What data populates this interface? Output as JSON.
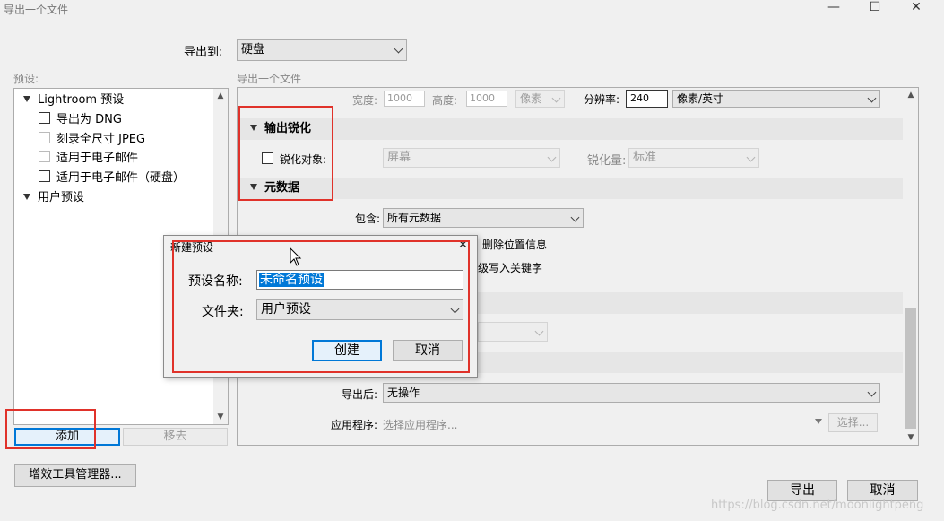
{
  "window": {
    "title": "导出一个文件",
    "minimize_glyph": "—",
    "maximize_glyph": "☐",
    "close_glyph": "✕"
  },
  "export_to": {
    "label": "导出到:",
    "value": "硬盘"
  },
  "presets": {
    "label": "预设:",
    "groups": [
      {
        "label": "Lightroom 预设"
      },
      {
        "label": "用户预设"
      }
    ],
    "items": [
      {
        "label": "导出为 DNG"
      },
      {
        "label": "刻录全尺寸 JPEG"
      },
      {
        "label": "适用于电子邮件"
      },
      {
        "label": "适用于电子邮件（硬盘）"
      }
    ],
    "add_label": "添加",
    "remove_label": "移去"
  },
  "plugin_manager_label": "增效工具管理器...",
  "main": {
    "heading": "导出一个文件",
    "size_row": {
      "width_label": "宽度:",
      "width_value": "1000",
      "height_label": "高度:",
      "height_value": "1000",
      "unit_value": "像素",
      "resolution_label": "分辨率:",
      "resolution_value": "240",
      "resolution_unit": "像素/英寸"
    },
    "sharpening": {
      "title": "输出锐化",
      "checkbox_label": "锐化对象:",
      "target_value": "屏幕",
      "amount_label": "锐化量:",
      "amount_value": "标准"
    },
    "metadata": {
      "title": "元数据",
      "include_label": "包含:",
      "include_value": "所有元数据",
      "remove_location_label": "删除位置信息",
      "keywords_label": "级写入关键字"
    },
    "post_processing": {
      "after_export_label": "导出后:",
      "after_export_value": "无操作",
      "application_label": "应用程序:",
      "application_placeholder": "选择应用程序...",
      "choose_label": "选择..."
    }
  },
  "new_preset_dialog": {
    "title": "新建预设",
    "name_label": "预设名称:",
    "name_value": "未命名预设",
    "folder_label": "文件夹:",
    "folder_value": "用户预设",
    "create_label": "创建",
    "cancel_label": "取消",
    "close_glyph": "✕"
  },
  "footer": {
    "export_label": "导出",
    "cancel_label": "取消"
  },
  "watermark": "https://blog.csdn.net/moonlightpeng",
  "colors": {
    "highlight_red": "#e0322a",
    "focus_blue": "#0078d7",
    "selection_blue": "#0078d7"
  }
}
